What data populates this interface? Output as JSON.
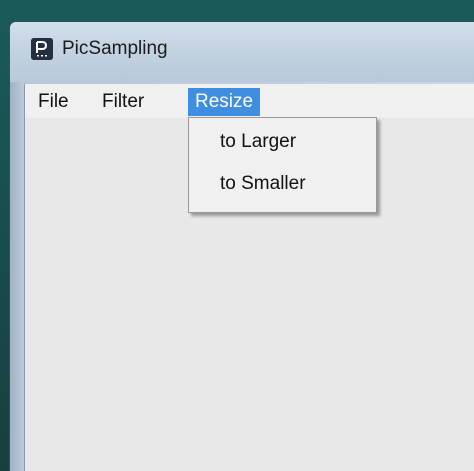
{
  "window": {
    "title": "PicSampling",
    "icon": "app-icon-p"
  },
  "menubar": {
    "items": [
      {
        "label": "File",
        "active": false
      },
      {
        "label": "Filter",
        "active": false
      },
      {
        "label": "Resize",
        "active": true
      }
    ]
  },
  "dropdown": {
    "items": [
      {
        "label": "to Larger"
      },
      {
        "label": "to Smaller"
      }
    ]
  },
  "colors": {
    "menu_highlight": "#3f8ee0",
    "client_background": "#e8e8e8"
  }
}
